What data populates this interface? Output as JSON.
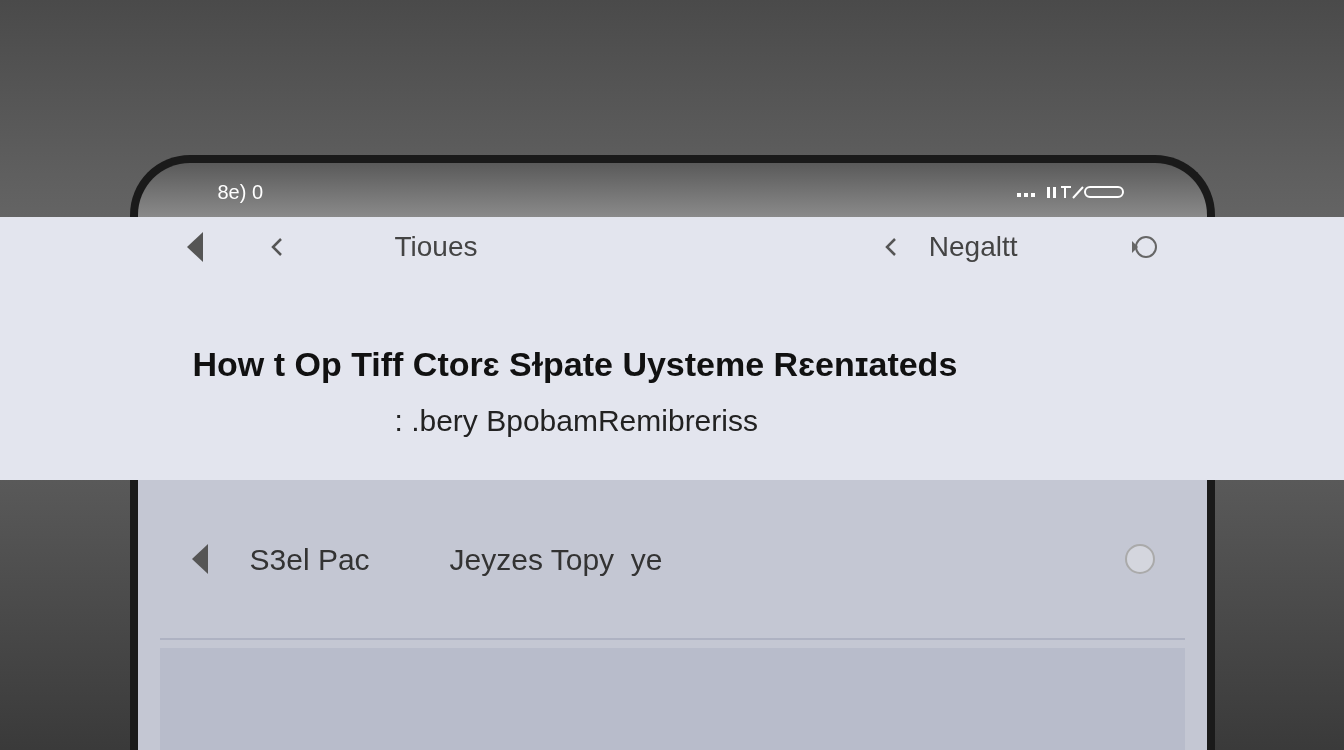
{
  "status_bar": {
    "left": "8e) 0"
  },
  "header": {
    "title": "Tioues",
    "right_label": "Negaltt"
  },
  "article": {
    "headline": "How t Op Tiff Ctorɛ Sɫpate Uysteme Rɛenɪateds",
    "subtitle": ": .bery BpobamRemibreriss"
  },
  "rows": [
    {
      "label": "S3el Pac",
      "value": "Jeyzes Topy  ye",
      "selected": false
    }
  ]
}
